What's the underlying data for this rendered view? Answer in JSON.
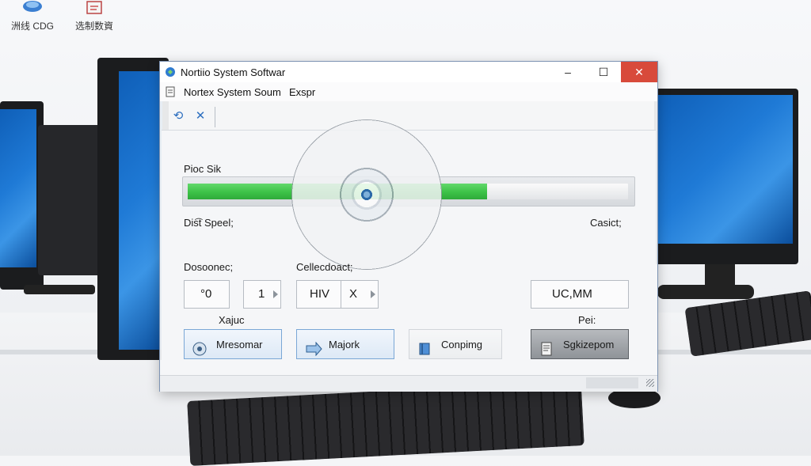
{
  "desktop": {
    "icons": [
      {
        "label": "洲线 CDG",
        "icon": "computer-icon"
      },
      {
        "label": "选制数資",
        "icon": "folder-icon"
      }
    ]
  },
  "window": {
    "title": "Nortiio System Softwar",
    "controls": {
      "minimize": "–",
      "maximize": "☐",
      "close": "✕"
    },
    "menu": [
      "Nortex System Soum",
      "Exspr"
    ],
    "toolbar": [
      {
        "icon": "refresh-icon",
        "glyph": "⟲"
      },
      {
        "icon": "close-icon",
        "glyph": "✕"
      }
    ]
  },
  "progress": {
    "label": "Pioc Sik",
    "fraction": 0.68,
    "left_caption": "Dis͡t Speel;",
    "right_caption": "Casict;"
  },
  "settings": {
    "group1_label": "Dosoonec;",
    "group2_label": "Cellecdoact;",
    "field1_value": "°0",
    "field2_value": "1",
    "field3_value": "HIV",
    "field4_value": "X",
    "field5_value": "UC,MM",
    "sub_label_left": "Xajuc",
    "sub_label_right": "Pei:"
  },
  "actions": [
    {
      "label": "Mresomar",
      "icon": "disc-icon"
    },
    {
      "label": "Majork",
      "icon": "arrow-right-icon"
    },
    {
      "label": "Conpimg",
      "icon": "book-icon"
    },
    {
      "label": "Sgkizepom",
      "icon": "document-icon"
    }
  ],
  "colors": {
    "progress_fill": "#3cc247",
    "close_button": "#d84a3b",
    "accent": "#2d6fbf"
  }
}
